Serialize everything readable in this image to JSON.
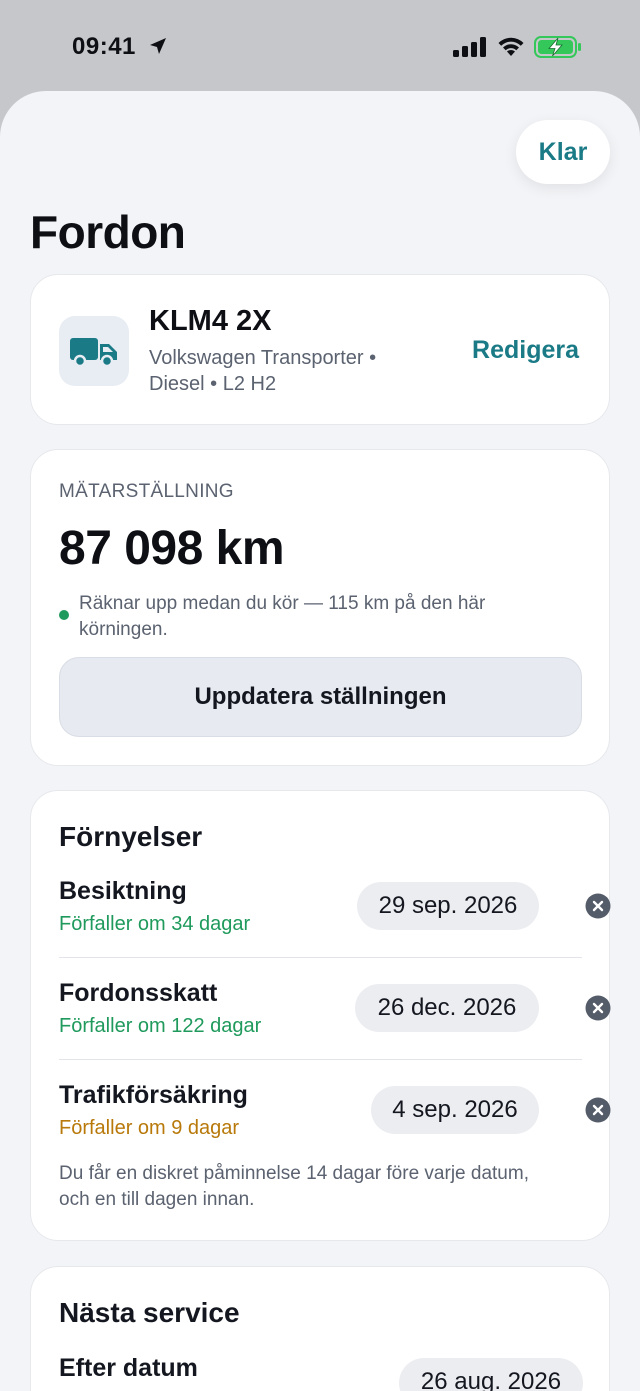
{
  "status_bar": {
    "time": "09:41",
    "icons": [
      "location-arrow-icon",
      "cellular-signal-icon",
      "wifi-icon",
      "battery-charging-icon"
    ],
    "battery_color": "#34c759"
  },
  "header": {
    "done_label": "Klar",
    "title": "Fordon"
  },
  "vehicle": {
    "icon": "truck-icon",
    "plate": "KLM4 2X",
    "description": "Volkswagen Transporter • Diesel • L2 H2",
    "edit_label": "Redigera"
  },
  "odometer": {
    "label": "MÄTARSTÄLLNING",
    "value": "87 098 km",
    "note": "Räknar upp medan du kör — 115 km på den här körningen.",
    "update_label": "Uppdatera ställningen"
  },
  "renewals": {
    "title": "Förnyelser",
    "items": [
      {
        "name": "Besiktning",
        "due": "Förfaller om 34 dagar",
        "status": "green",
        "date": "29 sep. 2026"
      },
      {
        "name": "Fordonsskatt",
        "due": "Förfaller om 122 dagar",
        "status": "green",
        "date": "26 dec. 2026"
      },
      {
        "name": "Trafikförsäkring",
        "due": "Förfaller om 9 dagar",
        "status": "amber",
        "date": "4 sep. 2026"
      }
    ],
    "footnote": "Du får en diskret påminnelse 14 dagar före varje datum, och en till dagen innan."
  },
  "service": {
    "title": "Nästa service",
    "by_date_label": "Efter datum",
    "date": "26 aug. 2026"
  },
  "colors": {
    "accent": "#1a7a86",
    "green": "#1f9a5c",
    "amber": "#b8790a"
  }
}
